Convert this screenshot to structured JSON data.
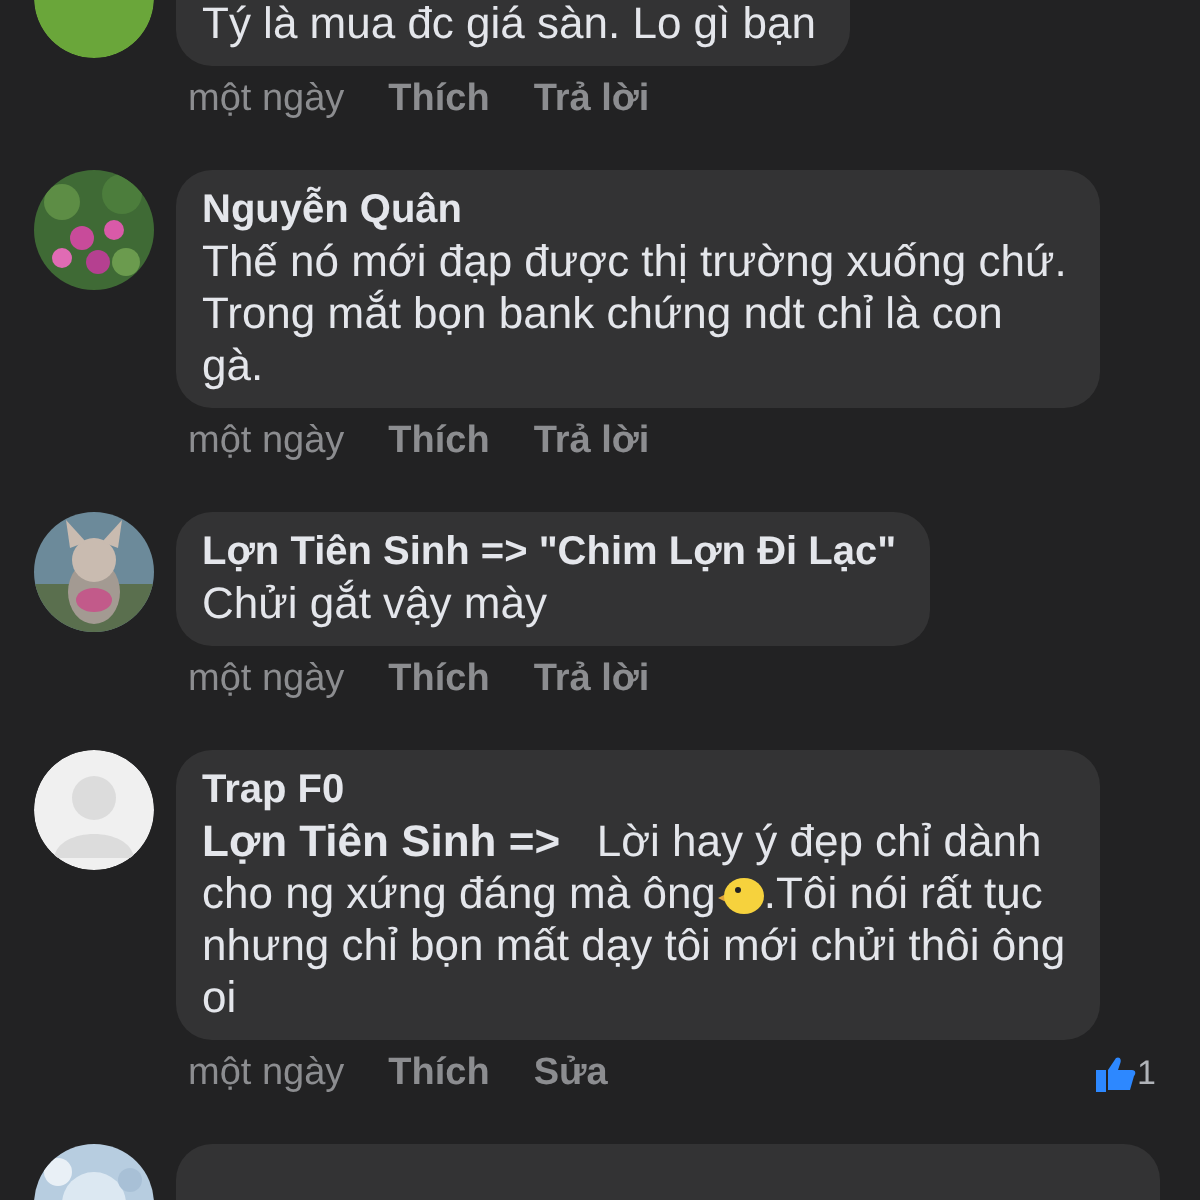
{
  "comments": [
    {
      "avatar": {
        "kind": "initial",
        "color": "#6aa63a"
      },
      "body": [
        [
          {
            "text": "Tý là mua đc giá sàn. Lo gì bạn"
          }
        ]
      ],
      "time": "một ngày",
      "actions": [
        "Thích",
        "Trả lời"
      ],
      "cut_top": true
    },
    {
      "avatar": {
        "kind": "picture"
      },
      "author": "Nguyễn Quân",
      "body": [
        [
          {
            "text": "Thế nó mới đạp được thị trường xuống chứ."
          }
        ],
        [
          {
            "text": "Trong mắt bọn bank chứng ndt chỉ là con"
          }
        ],
        [
          {
            "text": "gà."
          }
        ]
      ],
      "time": "một ngày",
      "actions": [
        "Thích",
        "Trả lời"
      ]
    },
    {
      "avatar": {
        "kind": "picture"
      },
      "author": "Lợn Tiên Sinh => \"Chim Lợn Đi Lạc\"",
      "body": [
        [
          {
            "text": "Chửi gắt vậy mày"
          }
        ]
      ],
      "time": "một ngày",
      "actions": [
        "Thích",
        "Trả lời"
      ]
    },
    {
      "avatar": {
        "kind": "default"
      },
      "author": "Trap F0",
      "body": [
        [
          {
            "text": "**Lợn Tiên Sinh =>**   Lời hay ý đẹp chỉ dành"
          }
        ],
        [
          {
            "text": "cho ng xứng đáng mà ông"
          },
          {
            "kind": "emoji"
          },
          {
            "text": ".Tôi nói rất tục"
          }
        ],
        [
          {
            "text": "nhưng chỉ bọn mất dạy tôi mới chửi thôi ông"
          }
        ],
        [
          {
            "text": "oi"
          }
        ]
      ],
      "time": "một ngày",
      "actions": [
        "Thích",
        "Sửa"
      ],
      "reactions": {
        "count": "1"
      }
    },
    {
      "avatar": {
        "kind": "picture"
      },
      "cut_bottom": true
    }
  ]
}
